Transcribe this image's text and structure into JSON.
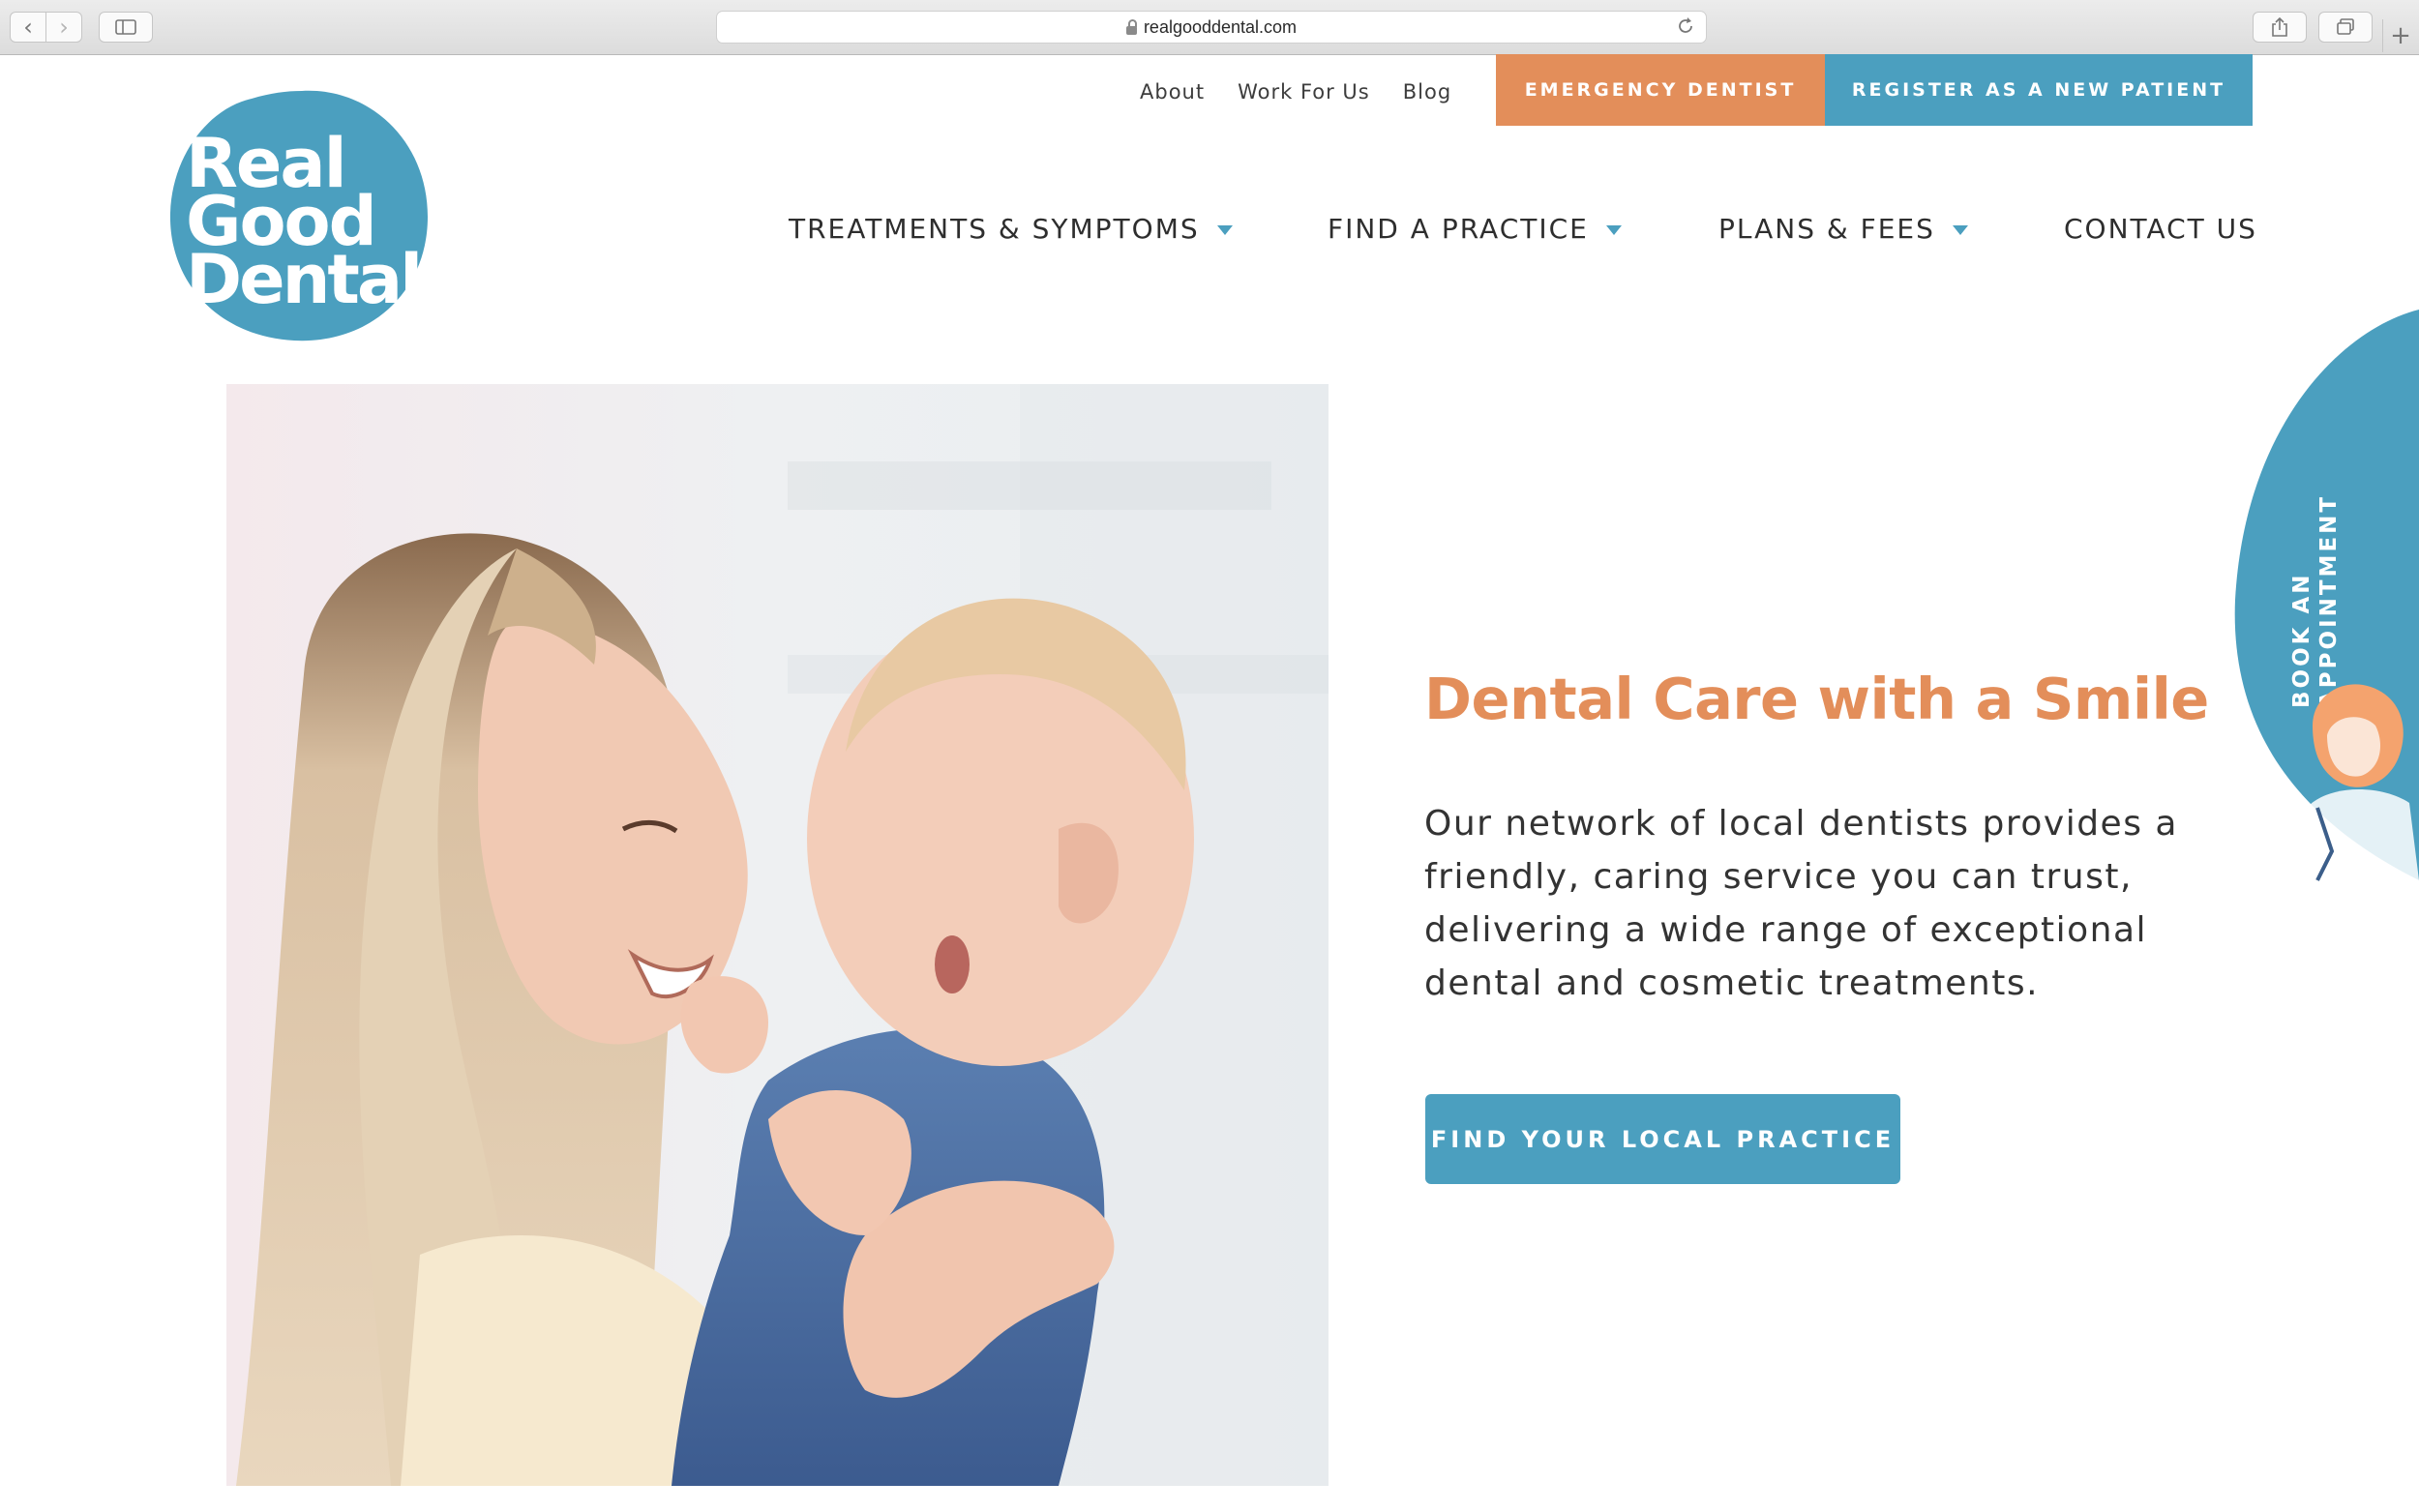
{
  "browser": {
    "url": "realgooddental.com",
    "back_glyph": "‹",
    "forward_glyph": "›",
    "new_tab_glyph": "+"
  },
  "logo": {
    "lines": [
      "Real",
      "Good",
      "Dental"
    ],
    "color": "#4b9fbf"
  },
  "top_links": [
    "About",
    "Work For Us",
    "Blog"
  ],
  "emergency_button": "EMERGENCY DENTIST",
  "register_button": "REGISTER AS A NEW PATIENT",
  "main_nav": [
    {
      "label": "TREATMENTS & SYMPTOMS",
      "dropdown": true
    },
    {
      "label": "FIND A PRACTICE",
      "dropdown": true
    },
    {
      "label": "PLANS & FEES",
      "dropdown": true
    },
    {
      "label": "CONTACT US",
      "dropdown": false
    }
  ],
  "hero": {
    "title": "Dental Care with a Smile",
    "text": "Our network of local dentists provides a friendly, caring service you can trust, delivering a wide range of exceptional dental and cosmetic treatments.",
    "cta": "FIND YOUR LOCAL PRACTICE"
  },
  "side_tab": {
    "lines": [
      "BOOK AN",
      "APPOINTMENT"
    ]
  },
  "colors": {
    "brand_blue": "#4b9fbf",
    "brand_orange": "#e38e5a",
    "text_dark": "#2e2e2e"
  }
}
